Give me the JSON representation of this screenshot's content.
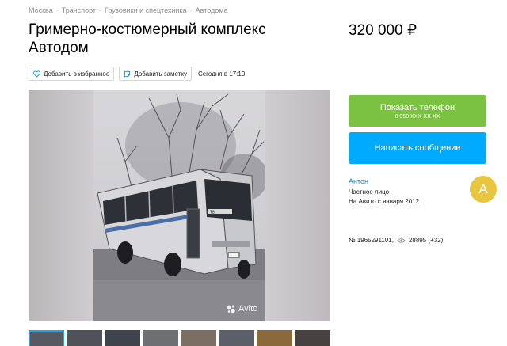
{
  "breadcrumbs": [
    "Москва",
    "Транспорт",
    "Грузовики и спецтехника",
    "Автодома"
  ],
  "title": "Гримерно-костюмерный комплекс Автодом",
  "price": "320 000 ₽",
  "actions": {
    "favorite_label": "Добавить в избранное",
    "note_label": "Добавить заметку",
    "date": "Сегодня в 17:10"
  },
  "gallery": {
    "watermark": "Avito",
    "bus_plate": "Т8"
  },
  "contact": {
    "phone_label": "Показать телефон",
    "phone_number": "8 958 ХХХ-ХХ-ХХ",
    "message_label": "Написать сообщение"
  },
  "seller": {
    "name": "Антон",
    "type": "Частное лицо",
    "since": "На Авито с января 2012",
    "avatar_letter": "А"
  },
  "stats": {
    "listing_id": "№ 1965291101,",
    "views": "28895 (+32)"
  },
  "colors": {
    "phone_button": "#7cc242",
    "message_button": "#00aaff",
    "link": "#0091d9",
    "avatar": "#e8c640"
  }
}
